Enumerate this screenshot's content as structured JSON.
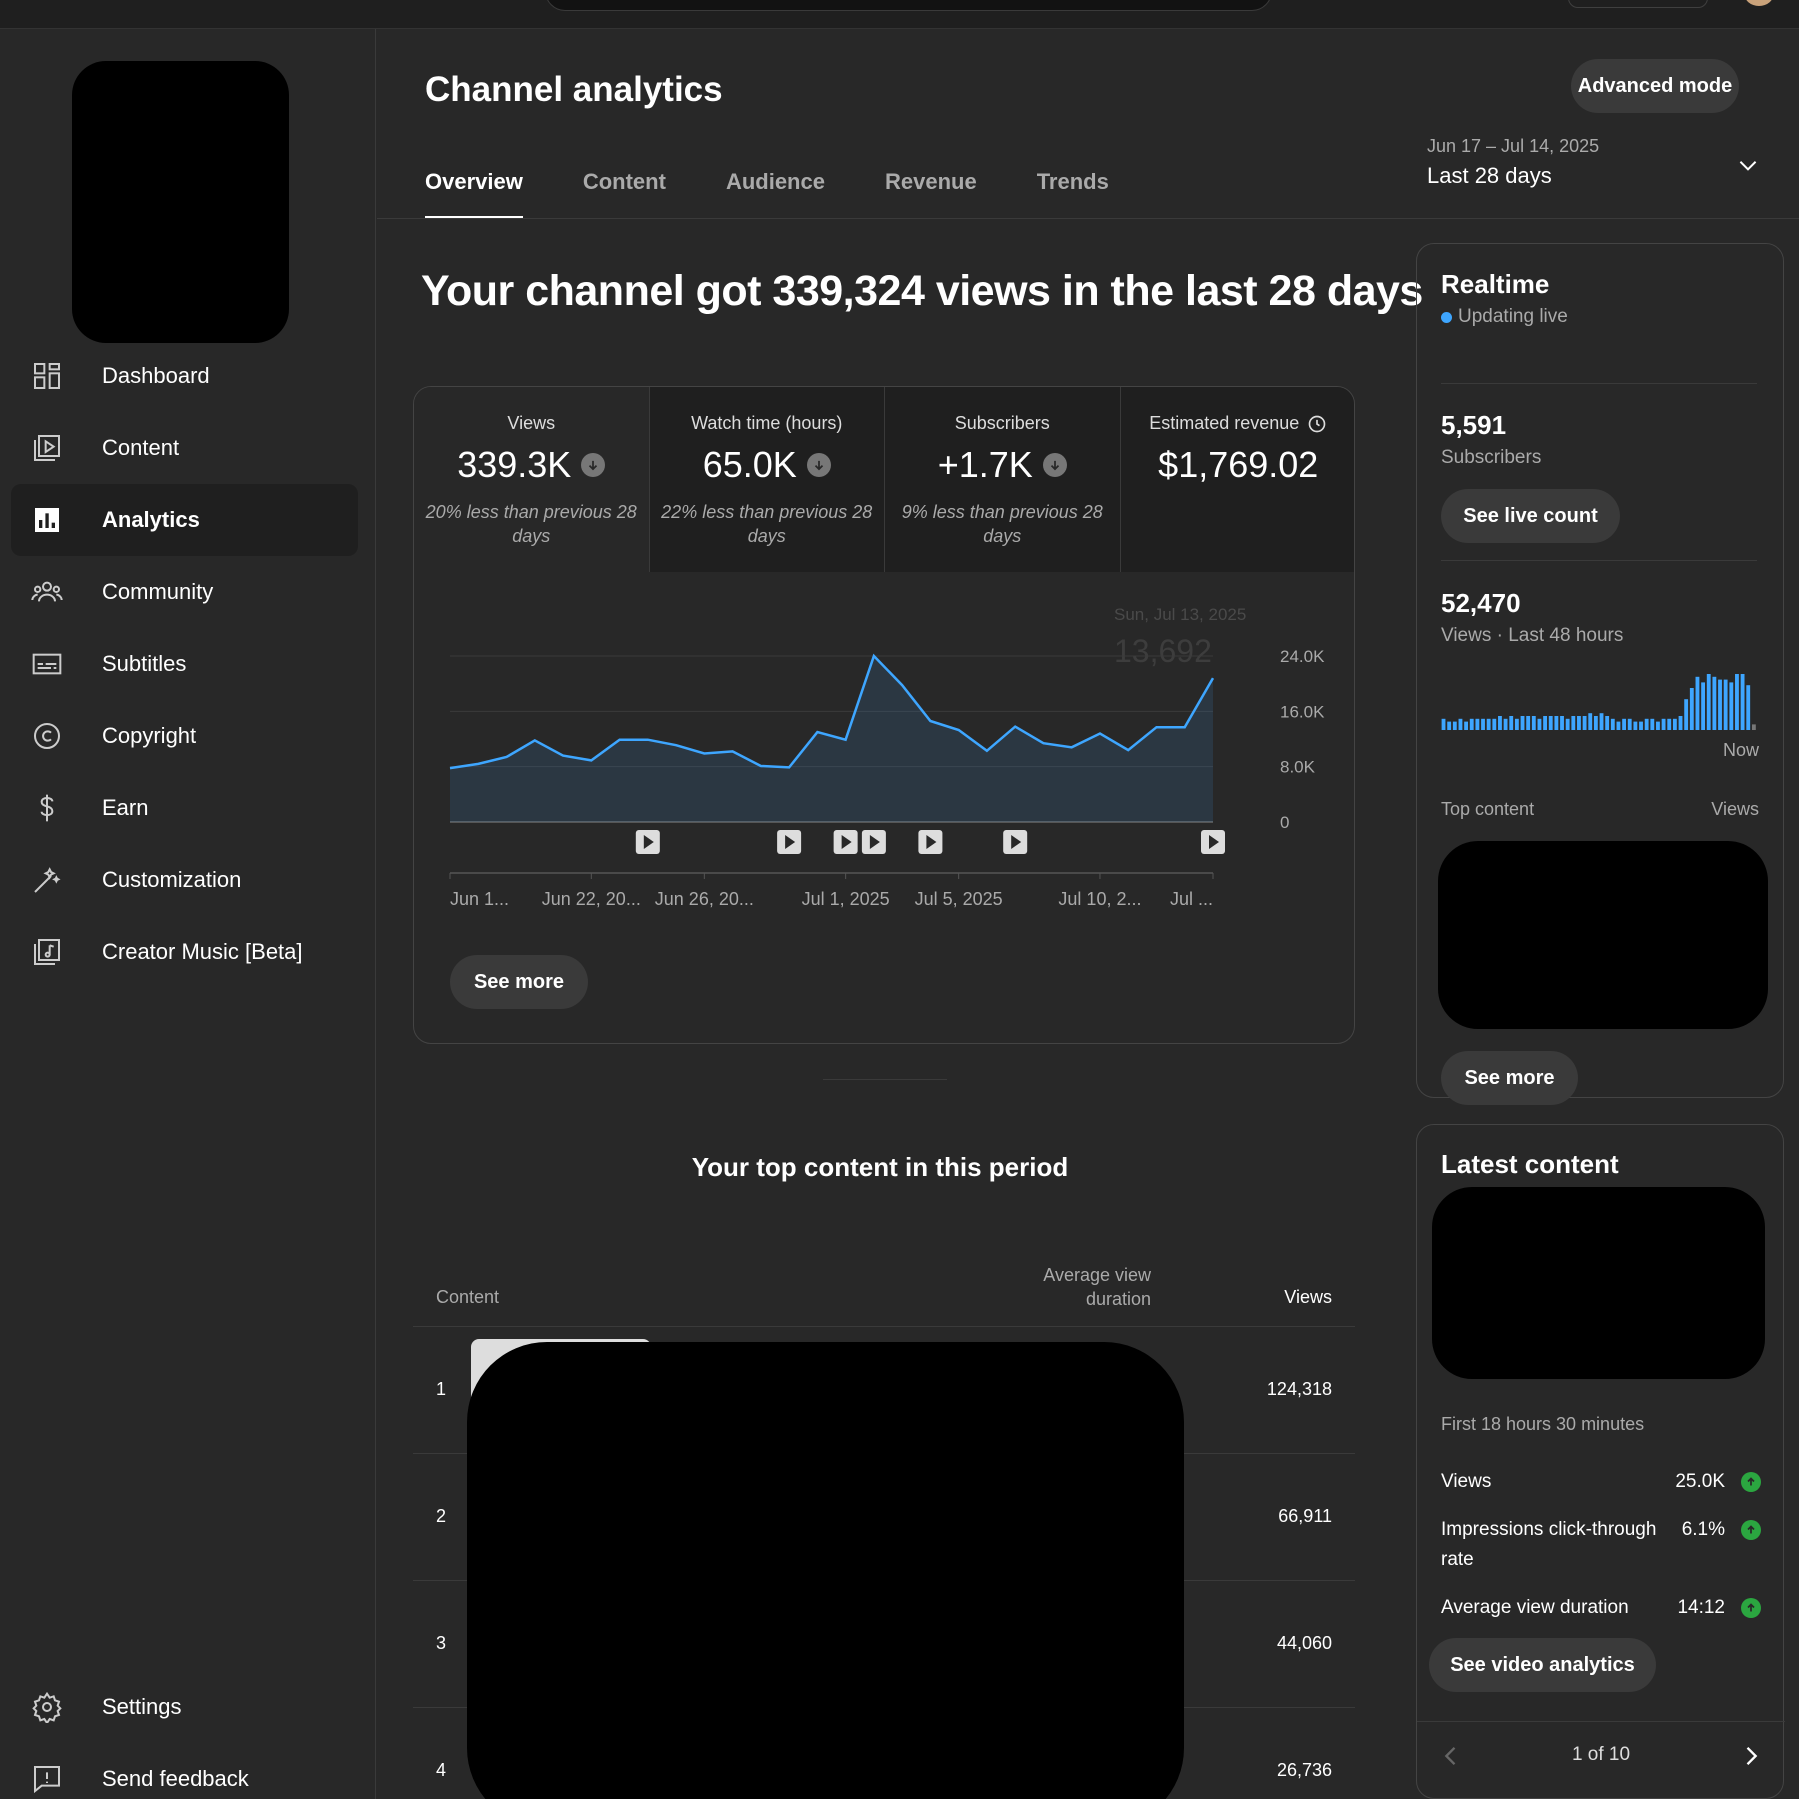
{
  "sidebar": {
    "items": [
      {
        "label": "Dashboard",
        "icon": "dashboard-icon"
      },
      {
        "label": "Content",
        "icon": "content-icon"
      },
      {
        "label": "Analytics",
        "icon": "analytics-icon"
      },
      {
        "label": "Community",
        "icon": "community-icon"
      },
      {
        "label": "Subtitles",
        "icon": "subtitles-icon"
      },
      {
        "label": "Copyright",
        "icon": "copyright-icon"
      },
      {
        "label": "Earn",
        "icon": "earn-icon"
      },
      {
        "label": "Customization",
        "icon": "customization-icon"
      },
      {
        "label": "Creator Music [Beta]",
        "icon": "creator-music-icon"
      }
    ],
    "settings_label": "Settings",
    "feedback_label": "Send feedback"
  },
  "header": {
    "title": "Channel analytics",
    "advanced_mode": "Advanced mode",
    "tabs": [
      "Overview",
      "Content",
      "Audience",
      "Revenue",
      "Trends"
    ],
    "date_range_sub": "Jun 17 – Jul 14, 2025",
    "date_range_label": "Last 28 days"
  },
  "headline": "Your channel got 339,324 views in the last 28 days",
  "metrics": [
    {
      "title": "Views",
      "value": "339.3K",
      "note": "20% less than previous 28 days"
    },
    {
      "title": "Watch time (hours)",
      "value": "65.0K",
      "note": "22% less than previous 28 days"
    },
    {
      "title": "Subscribers",
      "value": "+1.7K",
      "note": "9% less than previous 28 days"
    },
    {
      "title": "Estimated revenue",
      "value": "$1,769.02",
      "note": ""
    }
  ],
  "chart_data": {
    "type": "area",
    "series": [
      {
        "values": [
          7800,
          8400,
          9400,
          11800,
          9600,
          8900,
          11900,
          11900,
          11100,
          9900,
          10200,
          8100,
          7900,
          13000,
          11900,
          24000,
          19800,
          14600,
          13300,
          10300,
          13800,
          11400,
          10800,
          12800,
          10400,
          13700,
          13692,
          20800
        ]
      }
    ],
    "x_tick_labels": [
      "Jun 1...",
      "Jun 22, 20...",
      "Jun 26, 20...",
      "Jul 1, 2025",
      "Jul 5, 2025",
      "Jul 10, 2...",
      "Jul ..."
    ],
    "y_tick_labels": [
      "24.0K",
      "16.0K",
      "8.0K",
      "0"
    ],
    "ylim": [
      0,
      24000
    ],
    "tooltip_date": "Sun, Jul 13, 2025",
    "tooltip_value": "13,692",
    "line_color": "#3ea6ff",
    "video_markers_x_index": [
      7,
      12,
      14,
      15,
      17,
      20,
      27
    ]
  },
  "see_more_label": "See more",
  "top_content": {
    "title": "Your top content in this period",
    "col_content": "Content",
    "col_avd": "Average view duration",
    "col_views": "Views",
    "rows": [
      {
        "rank": "1",
        "views": "124,318"
      },
      {
        "rank": "2",
        "views": "66,911"
      },
      {
        "rank": "3",
        "views": "44,060"
      },
      {
        "rank": "4",
        "views": "26,736"
      }
    ]
  },
  "realtime": {
    "title": "Realtime",
    "live_text": "Updating live",
    "subscribers_value": "5,591",
    "subscribers_label": "Subscribers",
    "see_live_count": "See live count",
    "views_value": "52,470",
    "views_label": "Views · Last 48 hours",
    "now_label": "Now",
    "top_content_label": "Top content",
    "views_col_label": "Views",
    "see_more": "See more",
    "bars": [
      0.2,
      0.15,
      0.15,
      0.2,
      0.15,
      0.2,
      0.2,
      0.2,
      0.2,
      0.2,
      0.25,
      0.2,
      0.25,
      0.2,
      0.25,
      0.25,
      0.25,
      0.2,
      0.25,
      0.25,
      0.25,
      0.25,
      0.2,
      0.25,
      0.25,
      0.25,
      0.3,
      0.25,
      0.3,
      0.25,
      0.2,
      0.15,
      0.2,
      0.2,
      0.15,
      0.15,
      0.2,
      0.2,
      0.15,
      0.2,
      0.2,
      0.2,
      0.25,
      0.55,
      0.75,
      0.95,
      0.85,
      1.0,
      0.95,
      0.9,
      0.9,
      0.85,
      1.0,
      1.0,
      0.8,
      0.1
    ]
  },
  "latest": {
    "title": "Latest content",
    "first_period": "First 18 hours 30 minutes",
    "stats": [
      {
        "label": "Views",
        "value": "25.0K"
      },
      {
        "label": "Impressions click-through rate",
        "value": "6.1%"
      },
      {
        "label": "Average view duration",
        "value": "14:12"
      }
    ],
    "see_video_analytics": "See video analytics",
    "pager": "1 of 10"
  }
}
